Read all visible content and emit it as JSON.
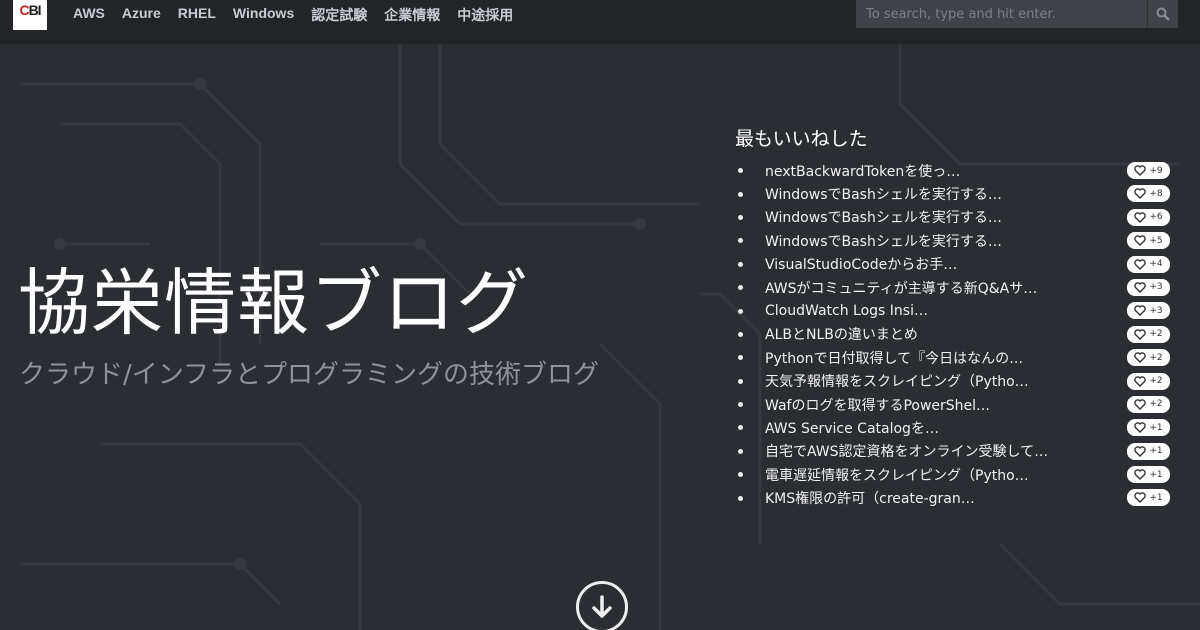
{
  "header": {
    "logo_text": "CBI",
    "nav": [
      "AWS",
      "Azure",
      "RHEL",
      "Windows",
      "認定試験",
      "企業情報",
      "中途採用"
    ],
    "search_placeholder": "To search, type and hit enter."
  },
  "hero": {
    "title": "協栄情報ブログ",
    "subtitle": "クラウド/インフラとプログラミングの技術ブログ"
  },
  "popular": {
    "heading": "最もいいねした",
    "items": [
      {
        "title": "nextBackwardTokenを使っ…",
        "likes": "+9"
      },
      {
        "title": "WindowsでBashシェルを実行する…",
        "likes": "+8"
      },
      {
        "title": "WindowsでBashシェルを実行する…",
        "likes": "+6"
      },
      {
        "title": "WindowsでBashシェルを実行する…",
        "likes": "+5"
      },
      {
        "title": "VisualStudioCodeからお手…",
        "likes": "+4"
      },
      {
        "title": "AWSがコミュニティが主導する新Q&Aサ…",
        "likes": "+3"
      },
      {
        "title": "CloudWatch Logs Insi…",
        "likes": "+3"
      },
      {
        "title": "ALBとNLBの違いまとめ",
        "likes": "+2"
      },
      {
        "title": "Pythonで日付取得して『今日はなんの…",
        "likes": "+2"
      },
      {
        "title": "天気予報情報をスクレイピング（Pytho…",
        "likes": "+2"
      },
      {
        "title": "Wafのログを取得するPowerShel…",
        "likes": "+2"
      },
      {
        "title": "AWS Service Catalogを…",
        "likes": "+1"
      },
      {
        "title": "自宅でAWS認定資格をオンライン受験して…",
        "likes": "+1"
      },
      {
        "title": "電車遅延情報をスクレイピング（Pytho…",
        "likes": "+1"
      },
      {
        "title": "KMS権限の許可（create-gran…",
        "likes": "+1"
      }
    ]
  }
}
